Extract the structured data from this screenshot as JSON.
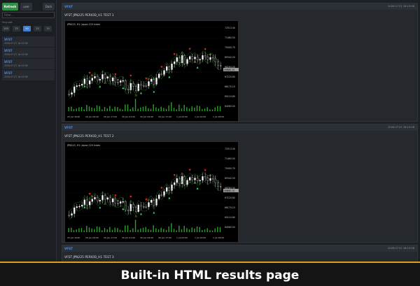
{
  "toolbar": {
    "refresh": "Refresh",
    "user": "user",
    "dark": "Dark"
  },
  "filter": {
    "placeholder": "Filter..."
  },
  "image_size": {
    "label": "Img size",
    "options": [
      "100",
      "75",
      "50",
      "25",
      "15"
    ],
    "active": "50"
  },
  "sidebar": {
    "items": [
      {
        "name": "VFST",
        "time": "2026.07.01 18:15:08"
      },
      {
        "name": "VFST",
        "time": "2026.07.01 18:15:08"
      },
      {
        "name": "VFST",
        "time": "2026.07.01 18:15:08"
      },
      {
        "name": "VFST",
        "time": "2026.07.01 18:15:08"
      }
    ]
  },
  "cards": [
    {
      "name": "VFST",
      "time": "2026.07.01 18:15:08",
      "title": "VFST JPN225 PERIOD_H1 TEST 1"
    },
    {
      "name": "VFST",
      "time": "2026.07.01 18:15:08",
      "title": "VFST JPN225 PERIOD_H1 TEST 2"
    },
    {
      "name": "VFST",
      "time": "2026.07.01 18:15:08",
      "title": "VFST JPN225 PERIOD_H1 TEST 3"
    }
  ],
  "chart": {
    "header": "JPN225, H1:  Japan 225 Index",
    "price_labels": [
      "72513.40",
      "71460.50",
      "70400.70",
      "69342.20",
      "68284.00",
      "67220.80",
      "66170.10",
      "65110.80",
      "64060.00"
    ],
    "current_price": "69880.10",
    "time_labels": [
      "25 Jun 2026",
      "29 Jun 09:00",
      "29 Jun 17:00",
      "30 Jun 01:00",
      "30 Jun 09:00",
      "30 Jun 17:00",
      "1 Jul 02:00",
      "1 Jul 10:00",
      "1 Jul 18:00"
    ],
    "colors": {
      "bg": "#000000",
      "grid": "#1d2a1d",
      "ma": "#2f9f2f",
      "buy": "#2ee06a",
      "sell": "#ff2b2b",
      "label": "#e0b400",
      "candle": "#ffffff"
    }
  },
  "banner": {
    "text": "Built-in HTML results page"
  }
}
